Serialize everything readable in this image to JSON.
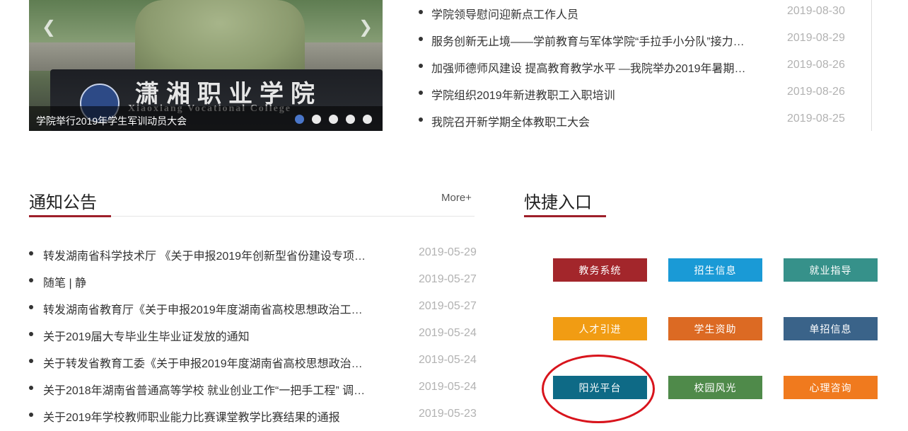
{
  "carousel": {
    "caption": "学院举行2019年学生军训动员大会",
    "podium_text": "潇湘职业学院",
    "podium_subtext": "Xiaoxiang Vocational College",
    "prev_icon": "chevron-left-icon",
    "next_icon": "chevron-right-icon",
    "slide_count": 5,
    "active_slide": 1
  },
  "top_news": [
    {
      "title": "学院领导慰问迎新点工作人员",
      "date": "2019-08-30"
    },
    {
      "title": "服务创新无止境——学前教育与军体学院“手拉手小分队”接力…",
      "date": "2019-08-29"
    },
    {
      "title": "加强师德师风建设 提高教育教学水平 —我院举办2019年暑期…",
      "date": "2019-08-26"
    },
    {
      "title": "学院组织2019年新进教职工入职培训",
      "date": "2019-08-26"
    },
    {
      "title": "我院召开新学期全体教职工大会",
      "date": "2019-08-25"
    }
  ],
  "notices": {
    "title": "通知公告",
    "more_label": "More+",
    "items": [
      {
        "title": "转发湖南省科学技术厅 《关于申报2019年创新型省份建设专项…",
        "date": "2019-05-29"
      },
      {
        "title": "随笔 | 静",
        "date": "2019-05-27"
      },
      {
        "title": "转发湖南省教育厅《关于申报2019年度湖南省高校思想政治工…",
        "date": "2019-05-27"
      },
      {
        "title": "关于2019届大专毕业生毕业证发放的通知",
        "date": "2019-05-24"
      },
      {
        "title": "关于转发省教育工委《关于申报2019年度湖南省高校思想政治…",
        "date": "2019-05-24"
      },
      {
        "title": "关于2018年湖南省普通高等学校 就业创业工作“一把手工程” 调…",
        "date": "2019-05-24"
      },
      {
        "title": "关于2019年学校教师职业能力比赛课堂教学比赛结果的通报",
        "date": "2019-05-23"
      }
    ]
  },
  "quick_links": {
    "title": "快捷入口",
    "items": [
      {
        "label": "教务系统",
        "color": "#a3262b"
      },
      {
        "label": "招生信息",
        "color": "#1a9ad6"
      },
      {
        "label": "就业指导",
        "color": "#36918a"
      },
      {
        "label": "人才引进",
        "color": "#f19c13"
      },
      {
        "label": "学生资助",
        "color": "#dc6a23"
      },
      {
        "label": "单招信息",
        "color": "#3a6389"
      },
      {
        "label": "阳光平台",
        "color": "#0e6a86"
      },
      {
        "label": "校园风光",
        "color": "#4f8a4a"
      },
      {
        "label": "心理咨询",
        "color": "#f07a1e"
      }
    ],
    "highlight_color": "#d8141c"
  }
}
